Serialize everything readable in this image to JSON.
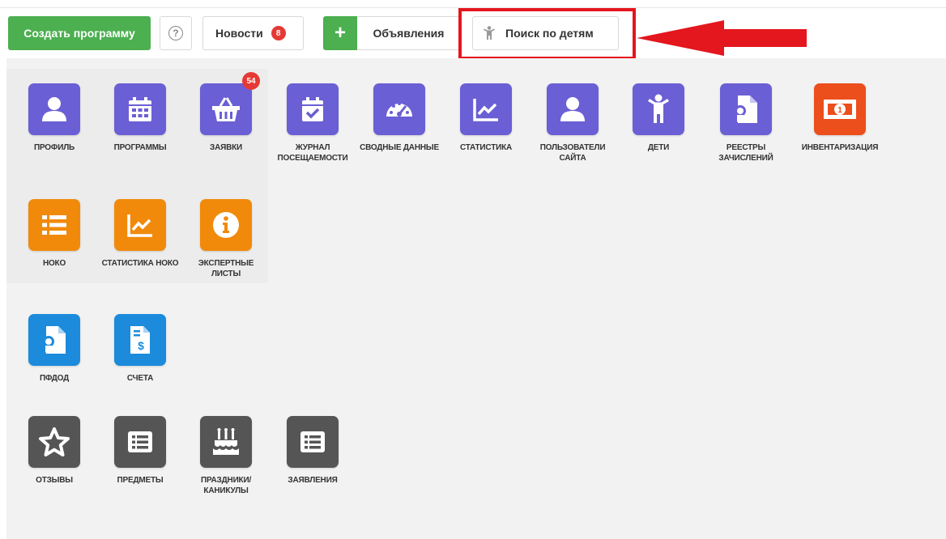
{
  "toolbar": {
    "create_label": "Создать программу",
    "help_symbol": "?",
    "news_label": "Новости",
    "news_count": "8",
    "plus_symbol": "+",
    "announcements_label": "Объявления",
    "search_children_label": "Поиск по детям",
    "highlight_color": "#e4161e"
  },
  "tiles": [
    {
      "label": "ПРОФИЛЬ",
      "icon": "user-icon",
      "color": "#6a5fd4"
    },
    {
      "label": "ПРОГРАММЫ",
      "icon": "calendar-icon",
      "color": "#6a5fd4"
    },
    {
      "label": "ЗАЯВКИ",
      "icon": "basket-icon",
      "color": "#6a5fd4",
      "badge": "54"
    },
    {
      "label": "ЖУРНАЛ ПОСЕЩАЕМОСТИ",
      "icon": "calendar-check-icon",
      "color": "#6a5fd4"
    },
    {
      "label": "СВОДНЫЕ ДАННЫЕ",
      "icon": "dashboard-icon",
      "color": "#6a5fd4"
    },
    {
      "label": "СТАТИСТИКА",
      "icon": "chart-line-icon",
      "color": "#6a5fd4"
    },
    {
      "label": "ПОЛЬЗОВАТЕЛИ САЙТА",
      "icon": "user-icon",
      "color": "#6a5fd4"
    },
    {
      "label": "ДЕТИ",
      "icon": "child-icon",
      "color": "#6a5fd4"
    },
    {
      "label": "РЕЕСТРЫ ЗАЧИСЛЕНИЙ",
      "icon": "certificate-file-icon",
      "color": "#6a5fd4"
    },
    {
      "label": "ИНВЕНТАРИЗАЦИЯ",
      "icon": "money-icon",
      "color": "#ec4e1c"
    },
    {
      "label": "НОКО",
      "icon": "list-icon",
      "color": "#f18a0b"
    },
    {
      "label": "СТАТИСТИКА НОКО",
      "icon": "chart-line-icon",
      "color": "#f18a0b"
    },
    {
      "label": "ЭКСПЕРТНЫЕ ЛИСТЫ",
      "icon": "info-icon",
      "color": "#f18a0b"
    },
    {
      "label": "ПФДОД",
      "icon": "certificate-file-icon",
      "color": "#1c8bdc"
    },
    {
      "label": "СЧЕТА",
      "icon": "invoice-icon",
      "color": "#1c8bdc"
    },
    {
      "label": "ОТЗЫВЫ",
      "icon": "star-icon",
      "color": "#555555"
    },
    {
      "label": "ПРЕДМЕТЫ",
      "icon": "list-alt-icon",
      "color": "#555555"
    },
    {
      "label": "ПРАЗДНИКИ/ КАНИКУЛЫ",
      "icon": "birthday-cake-icon",
      "color": "#555555"
    },
    {
      "label": "ЗАЯВЛЕНИЯ",
      "icon": "list-alt-icon",
      "color": "#555555"
    }
  ]
}
